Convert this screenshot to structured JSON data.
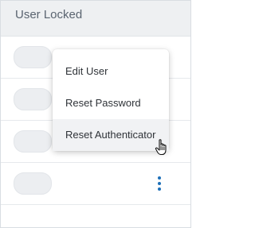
{
  "header": {
    "title": "User Locked"
  },
  "rows": [
    {
      "toggle_state": "off"
    },
    {
      "toggle_state": "off"
    },
    {
      "toggle_state": "off"
    },
    {
      "toggle_state": "off"
    }
  ],
  "context_menu": {
    "items": [
      {
        "label": "Edit User"
      },
      {
        "label": "Reset Password"
      },
      {
        "label": "Reset Authenticator",
        "hovered": true
      }
    ]
  },
  "colors": {
    "accent": "#1d6fb8",
    "header_bg": "#eef0f2",
    "toggle_off": "#eceef1",
    "menu_hover": "#f1f2f4"
  },
  "icons": {
    "row_action": "kebab-icon",
    "pointer": "hand-cursor-icon"
  }
}
